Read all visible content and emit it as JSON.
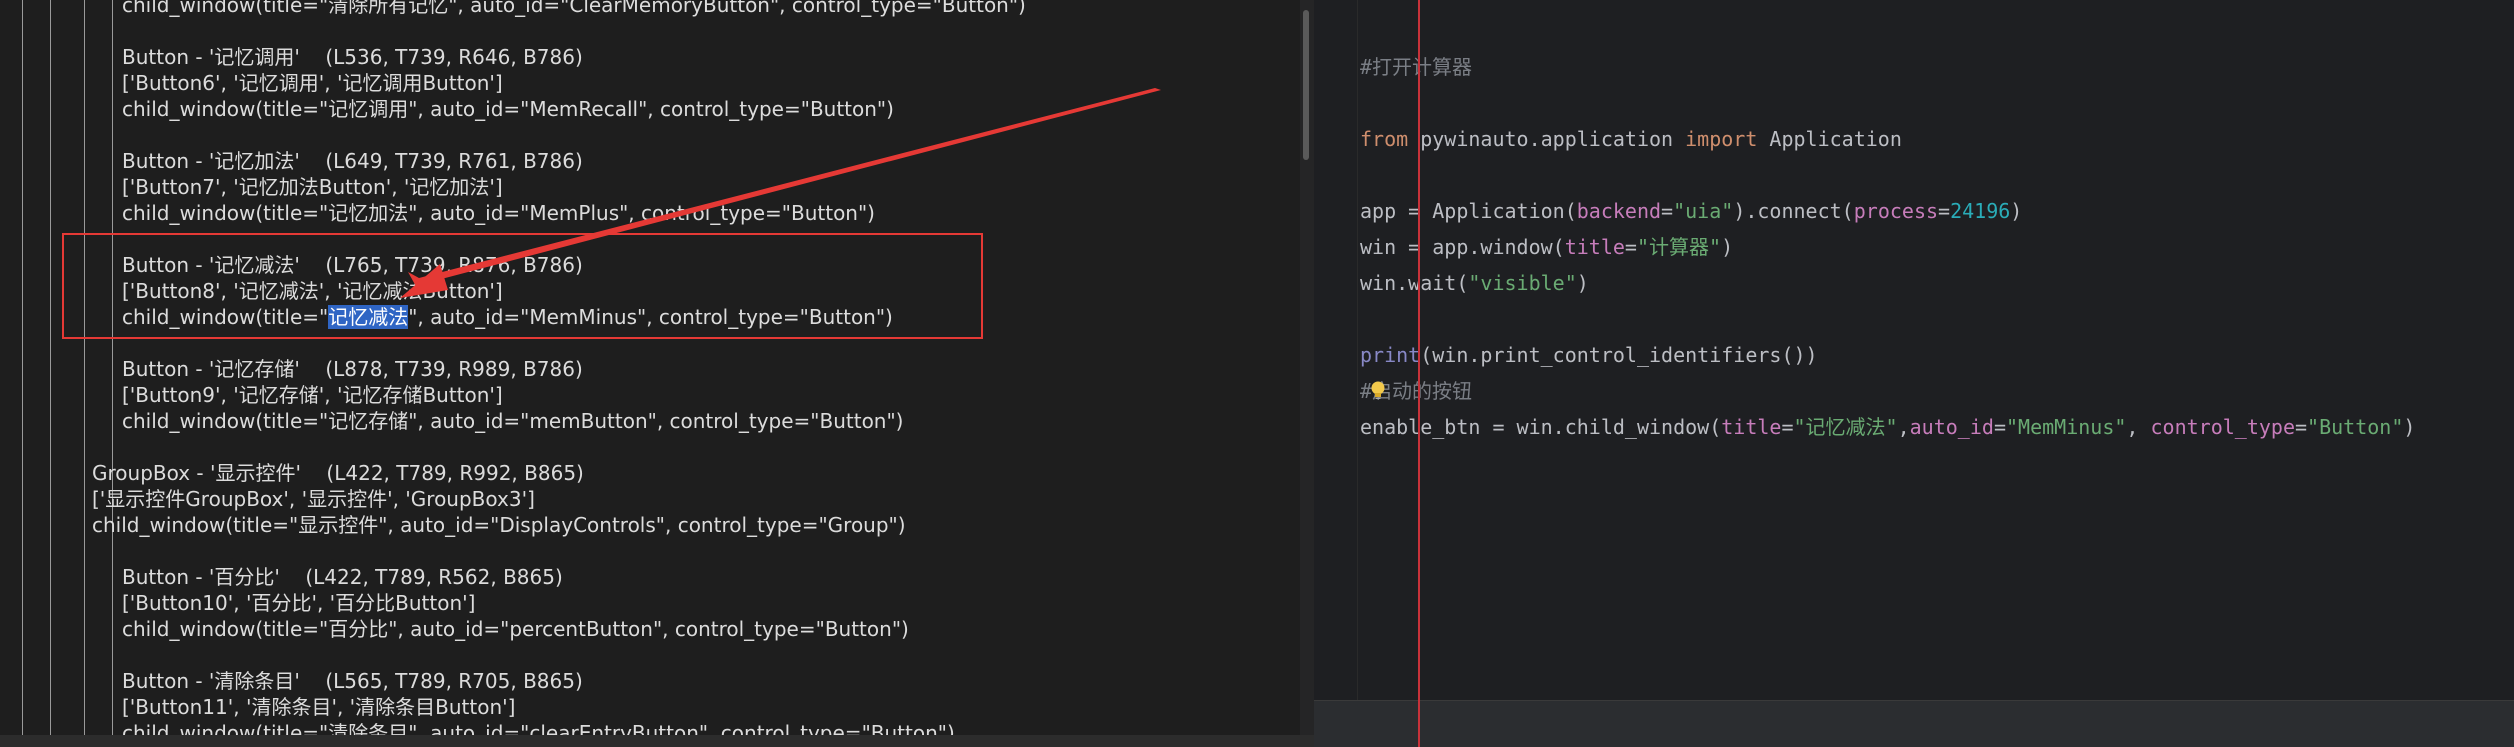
{
  "left_tree": [
    {
      "indent": 3,
      "text": "child_window(title=\"清除所有记忆\", auto_id=\"ClearMemoryButton\", control_type=\"Button\")"
    },
    {
      "indent": 3,
      "text": ""
    },
    {
      "indent": 3,
      "text": "Button - '记忆调用'    (L536, T739, R646, B786)"
    },
    {
      "indent": 3,
      "text": "['Button6', '记忆调用', '记忆调用Button']"
    },
    {
      "indent": 3,
      "text": "child_window(title=\"记忆调用\", auto_id=\"MemRecall\", control_type=\"Button\")"
    },
    {
      "indent": 3,
      "text": ""
    },
    {
      "indent": 3,
      "text": "Button - '记忆加法'    (L649, T739, R761, B786)"
    },
    {
      "indent": 3,
      "text": "['Button7', '记忆加法Button', '记忆加法']"
    },
    {
      "indent": 3,
      "text": "child_window(title=\"记忆加法\", auto_id=\"MemPlus\", control_type=\"Button\")"
    },
    {
      "indent": 3,
      "text": ""
    },
    {
      "indent": 3,
      "text": "Button - '记忆减法'    (L765, T739, R876, B786)"
    },
    {
      "indent": 3,
      "text": "['Button8', '记忆减法', '记忆减法Button']"
    },
    {
      "indent": 3,
      "text": "child_window(title=\"",
      "hl": "记忆减法",
      "after": "\", auto_id=\"MemMinus\", control_type=\"Button\")"
    },
    {
      "indent": 3,
      "text": ""
    },
    {
      "indent": 3,
      "text": "Button - '记忆存储'    (L878, T739, R989, B786)"
    },
    {
      "indent": 3,
      "text": "['Button9', '记忆存储', '记忆存储Button']"
    },
    {
      "indent": 3,
      "text": "child_window(title=\"记忆存储\", auto_id=\"memButton\", control_type=\"Button\")"
    },
    {
      "indent": 2,
      "text": ""
    },
    {
      "indent": 2,
      "text": "GroupBox - '显示控件'    (L422, T789, R992, B865)"
    },
    {
      "indent": 2,
      "text": "['显示控件GroupBox', '显示控件', 'GroupBox3']"
    },
    {
      "indent": 2,
      "text": "child_window(title=\"显示控件\", auto_id=\"DisplayControls\", control_type=\"Group\")"
    },
    {
      "indent": 3,
      "text": ""
    },
    {
      "indent": 3,
      "text": "Button - '百分比'    (L422, T789, R562, B865)"
    },
    {
      "indent": 3,
      "text": "['Button10', '百分比', '百分比Button']"
    },
    {
      "indent": 3,
      "text": "child_window(title=\"百分比\", auto_id=\"percentButton\", control_type=\"Button\")"
    },
    {
      "indent": 3,
      "text": ""
    },
    {
      "indent": 3,
      "text": "Button - '清除条目'    (L565, T789, R705, B865)"
    },
    {
      "indent": 3,
      "text": "['Button11', '清除条目', '清除条目Button']"
    },
    {
      "indent": 3,
      "text": "child_window(title=\"清除条目\", auto_id=\"clearEntryButton\", control_type=\"Button\")"
    }
  ],
  "code": {
    "comment_open": "#打开计算器",
    "line_import": {
      "kw1": "from",
      "mod": " pywinauto.application ",
      "kw2": "import",
      "rest": " Application"
    },
    "line_app": {
      "a": "app = Application(",
      "p1": "backend",
      "e1": "=",
      "s1": "\"uia\"",
      "b": ").connect(",
      "p2": "process",
      "e2": "=",
      "n": "24196",
      "c": ")"
    },
    "line_win": {
      "a": "win = app.window(",
      "p": "title",
      "e": "=",
      "s": "\"计算器\"",
      "c": ")"
    },
    "line_wait": {
      "a": "win.wait(",
      "s": "\"visible\"",
      "c": ")"
    },
    "line_print": {
      "fn": "print",
      "rest": "(win.print_control_identifiers())"
    },
    "comment_enable": "#启动的按钮",
    "line_enable": {
      "a": "enable_btn = win.child_window(",
      "p1": "title",
      "e1": "=",
      "s1": "\"记忆减法\"",
      "c1": ",",
      "p2": "auto_id",
      "e2": "=",
      "s2": "\"MemMinus\"",
      "c2": ", ",
      "p3": "control_type",
      "e3": "=",
      "s3": "\"Button\"",
      "c3": ")"
    }
  },
  "colors": {
    "highlight_box": "#e53935",
    "arrow": "#e53935",
    "margin_line": "#c8323a"
  }
}
